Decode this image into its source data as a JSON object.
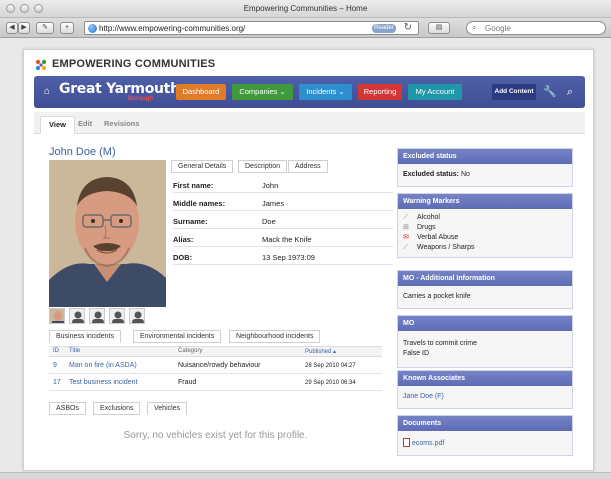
{
  "browser": {
    "window_title": "Empowering Communities – Home",
    "url": "http://www.empowering-communities.org/",
    "reader_label": "Reader",
    "search_placeholder": "Google"
  },
  "site": {
    "logo_text": "EMPOWERING COMMUNITIES",
    "brand": "Great Yarmouth",
    "brand_sub": "Borough"
  },
  "nav": {
    "items": [
      {
        "label": "Dashboard",
        "color": "#e07b28"
      },
      {
        "label": "Companies",
        "color": "#3f9a3c",
        "chevron": true
      },
      {
        "label": "Incidents",
        "color": "#2e8fd0",
        "chevron": true
      },
      {
        "label": "Reporting",
        "color": "#d43535"
      },
      {
        "label": "My Account",
        "color": "#1f97a8"
      }
    ],
    "add_content": "Add Content"
  },
  "page_tabs": [
    "View",
    "Edit",
    "Revisions"
  ],
  "person": {
    "name": "John Doe (M)"
  },
  "detail_tabs": [
    "General Details",
    "Description",
    "Address"
  ],
  "details": [
    {
      "label": "First name:",
      "value": "John"
    },
    {
      "label": "Middle names:",
      "value": "James"
    },
    {
      "label": "Surname:",
      "value": "Doe"
    },
    {
      "label": "Alias:",
      "value": "Mack the Knife"
    },
    {
      "label": "DOB:",
      "value": "13 Sep 1973:09"
    }
  ],
  "incident_tabs": [
    "Business incidents",
    "Environmental incidents",
    "Neighbourhood incidents"
  ],
  "incidents": {
    "headers": {
      "id": "ID",
      "title": "Title",
      "category": "Category",
      "published": "Published"
    },
    "rows": [
      {
        "id": "9",
        "title": "Man on fire (in ASDA)",
        "category": "Nuisance/rowdy behaviour",
        "published": "28 Sep 2010 04:27"
      },
      {
        "id": "17",
        "title": "Test business incident",
        "category": "Fraud",
        "published": "29 Sep 2010 06:34"
      }
    ]
  },
  "vehicle_tabs": [
    "ASBOs",
    "Exclusions",
    "Vehicles"
  ],
  "vehicles_empty": "Sorry, no vehicles exist yet for this profile.",
  "sidebar": {
    "excluded": {
      "title": "Excluded status",
      "label": "Excluded status:",
      "value": "No"
    },
    "warnings": {
      "title": "Warning Markers",
      "items": [
        "Alcohol",
        "Drugs",
        "Verbal Abuse",
        "Weapons / Sharps"
      ]
    },
    "mo_info": {
      "title": "MO - Additional Information",
      "text": "Carries a pocket knife"
    },
    "mo": {
      "title": "MO",
      "lines": [
        "Travels to commit crime",
        "False ID"
      ]
    },
    "associates": {
      "title": "Known Associates",
      "items": [
        "Jane Doe (F)"
      ]
    },
    "documents": {
      "title": "Documents",
      "items": [
        "ecoms.pdf"
      ]
    }
  }
}
